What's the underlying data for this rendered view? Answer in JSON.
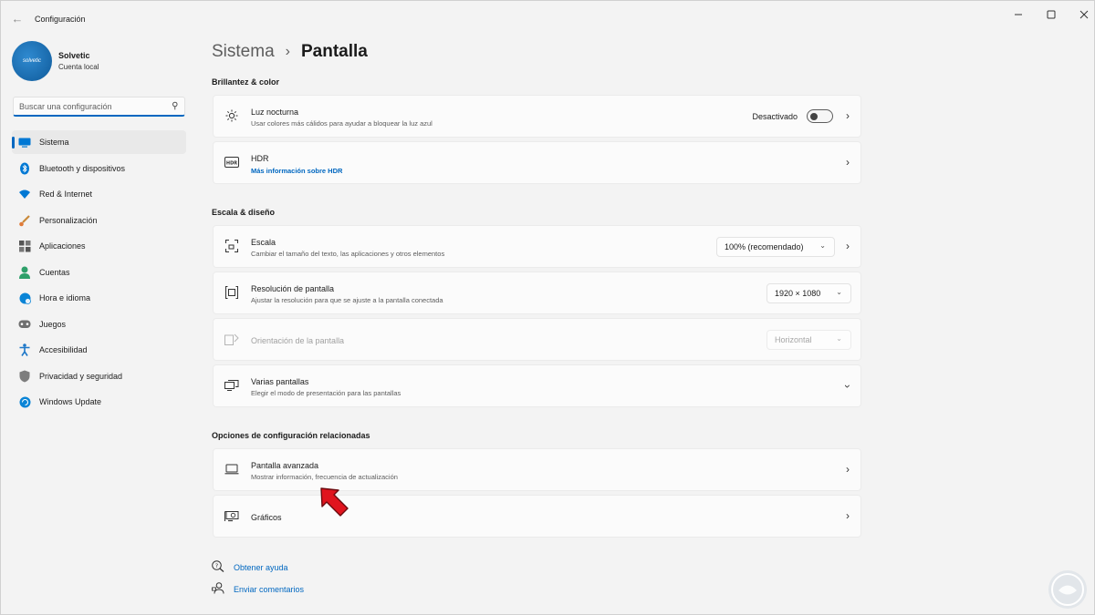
{
  "window": {
    "title": "Configuración",
    "back_icon": "back-arrow-icon"
  },
  "profile": {
    "name": "Solvetic",
    "account_type": "Cuenta local",
    "avatar_text": "solvetic"
  },
  "search": {
    "placeholder": "Buscar una configuración"
  },
  "sidebar": {
    "items": [
      {
        "label": "Sistema",
        "icon": "monitor-icon",
        "active": true
      },
      {
        "label": "Bluetooth y dispositivos",
        "icon": "bluetooth-icon"
      },
      {
        "label": "Red & Internet",
        "icon": "wifi-icon"
      },
      {
        "label": "Personalización",
        "icon": "brush-icon"
      },
      {
        "label": "Aplicaciones",
        "icon": "apps-icon"
      },
      {
        "label": "Cuentas",
        "icon": "person-icon"
      },
      {
        "label": "Hora e idioma",
        "icon": "globe-icon"
      },
      {
        "label": "Juegos",
        "icon": "gamepad-icon"
      },
      {
        "label": "Accesibilidad",
        "icon": "accessibility-icon"
      },
      {
        "label": "Privacidad y seguridad",
        "icon": "shield-icon"
      },
      {
        "label": "Windows Update",
        "icon": "update-icon"
      }
    ]
  },
  "breadcrumb": {
    "parent": "Sistema",
    "separator": "›",
    "current": "Pantalla"
  },
  "sections": {
    "brightness": "Brillantez & color",
    "scale": "Escala & diseño",
    "related": "Opciones de configuración relacionadas"
  },
  "cards": {
    "night_light": {
      "title": "Luz nocturna",
      "subtitle": "Usar colores más cálidos para ayudar a bloquear la luz azul",
      "state": "Desactivado"
    },
    "hdr": {
      "title": "HDR",
      "link": "Más información sobre HDR",
      "icon_text": "HDR"
    },
    "scale": {
      "title": "Escala",
      "subtitle": "Cambiar el tamaño del texto, las aplicaciones y otros elementos",
      "value": "100% (recomendado)"
    },
    "resolution": {
      "title": "Resolución de pantalla",
      "subtitle": "Ajustar la resolución para que se ajuste a la pantalla conectada",
      "value": "1920 × 1080"
    },
    "orientation": {
      "title": "Orientación de la pantalla",
      "value": "Horizontal"
    },
    "multiple": {
      "title": "Varias pantallas",
      "subtitle": "Elegir el modo de presentación para las pantallas"
    },
    "advanced": {
      "title": "Pantalla avanzada",
      "subtitle": "Mostrar información, frecuencia de actualización"
    },
    "graphics": {
      "title": "Gráficos"
    }
  },
  "footer": {
    "help": "Obtener ayuda",
    "feedback": "Enviar comentarios"
  },
  "colors": {
    "accent": "#0067c0",
    "annotation_arrow": "#e0141e"
  }
}
